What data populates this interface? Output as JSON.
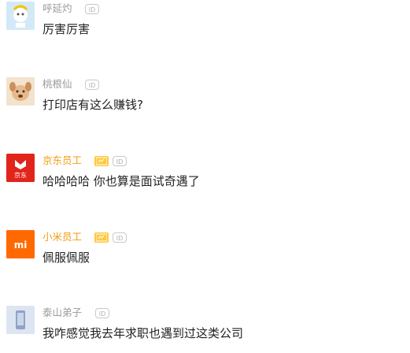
{
  "comments": [
    {
      "name": "呼延灼",
      "text": "厉害厉害",
      "badge_id": "ID"
    },
    {
      "name": "桃根仙",
      "text": "打印店有这么赚钱?",
      "badge_id": "ID"
    },
    {
      "name": "京东员工",
      "text": "哈哈哈哈 你也算是面试奇遇了",
      "badge_id": "ID",
      "logo_text": "京东"
    },
    {
      "name": "小米员工",
      "text": "佩服佩服",
      "badge_id": "ID",
      "logo_text": "mi"
    },
    {
      "name": "泰山弟子",
      "text": "我咋感觉我去年求职也遇到过这类公司",
      "badge_id": "ID"
    }
  ],
  "colors": {
    "name_gray": "#9a9a9a",
    "name_company": "#f39c12",
    "jd_red": "#e1251b",
    "mi_orange": "#ff6900"
  }
}
